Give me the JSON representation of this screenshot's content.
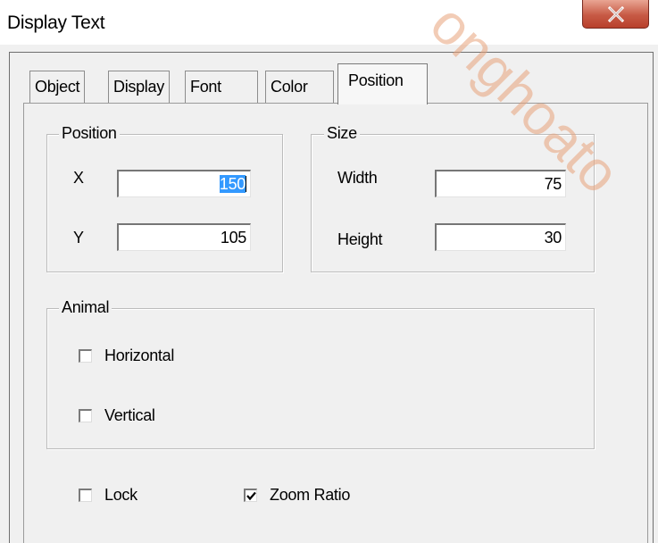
{
  "window": {
    "title": "Display Text",
    "close_icon": "close-x-icon",
    "close_color": "#c75a45"
  },
  "watermark": "onghoato",
  "tabs": [
    {
      "label": "Object"
    },
    {
      "label": "Display"
    },
    {
      "label": "Font"
    },
    {
      "label": "Color"
    },
    {
      "label": "Position",
      "active": true
    }
  ],
  "position_group": {
    "legend": "Position",
    "x_label": "X",
    "x_value": "150",
    "y_label": "Y",
    "y_value": "105"
  },
  "size_group": {
    "legend": "Size",
    "width_label": "Width",
    "width_value": "75",
    "height_label": "Height",
    "height_value": "30"
  },
  "animal_group": {
    "legend": "Animal",
    "horizontal_label": "Horizontal",
    "horizontal_checked": false,
    "vertical_label": "Vertical",
    "vertical_checked": false
  },
  "options": {
    "lock_label": "Lock",
    "lock_checked": false,
    "zoom_ratio_label": "Zoom Ratio",
    "zoom_ratio_checked": true
  }
}
